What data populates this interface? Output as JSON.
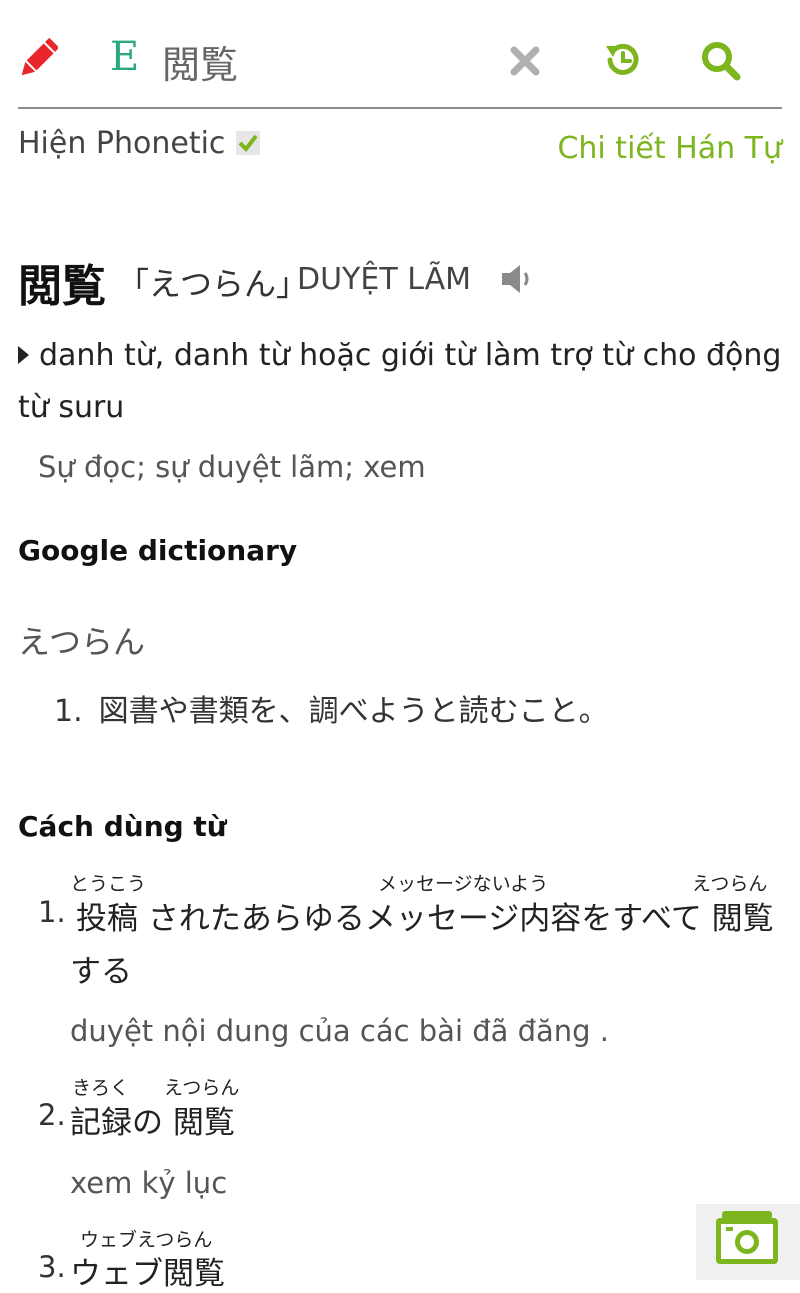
{
  "header": {
    "lang_badge": "E",
    "query": "閲覧",
    "icons": {
      "edit": "pencil-icon",
      "clear": "close-icon",
      "history": "history-icon",
      "search": "search-icon",
      "camera": "camera-icon"
    }
  },
  "options": {
    "phonetic_label": "Hiện Phonetic",
    "phonetic_checked": true,
    "kanji_detail_link": "Chi tiết Hán Tự"
  },
  "entry": {
    "word": "閲覧",
    "reading": "「えつらん」",
    "han_viet": "DUYỆT LÃM",
    "part_of_speech": "danh từ, danh từ hoặc giới từ làm trợ từ cho động từ suru",
    "meaning": "Sự đọc; sự duyệt lãm; xem"
  },
  "google_dictionary": {
    "heading": "Google dictionary",
    "reading": "えつらん",
    "definitions": [
      {
        "num": "1.",
        "text": "図書や書類を、調べようと読むこと。"
      }
    ]
  },
  "usage": {
    "heading": "Cách dùng từ",
    "examples": [
      {
        "num": "1.",
        "sentence_line1": "投稿 されたあらゆるメッセージ内容をすべて 閲覧",
        "sentence_line2": "する",
        "ruby": [
          "とうこう",
          "メッセージないよう",
          "えつらん"
        ],
        "translation": "duyệt nội dung của các bài đã đăng ."
      },
      {
        "num": "2.",
        "sentence_line1": "記録の 閲覧",
        "ruby": [
          "きろく",
          "えつらん"
        ],
        "translation": "xem kỷ lục"
      },
      {
        "num": "3.",
        "sentence_line1": "ウェブ閲覧",
        "ruby": [
          "ウェブえつらん"
        ]
      }
    ]
  },
  "colors": {
    "accent_green": "#7cb51e",
    "edit_red": "#e8262b",
    "lang_teal": "#2aa77f",
    "divider": "#8c8c8c"
  }
}
